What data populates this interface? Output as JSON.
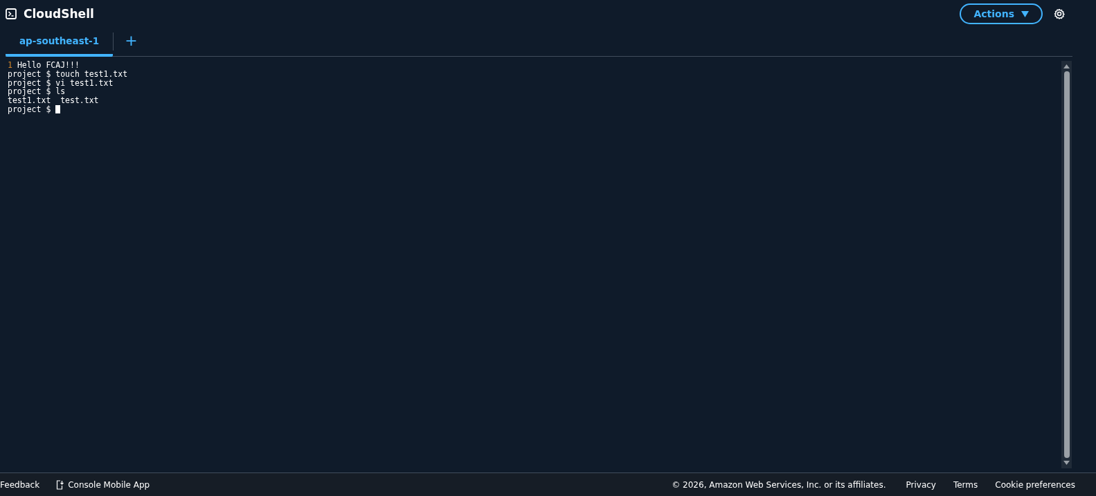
{
  "header": {
    "title": "CloudShell",
    "actions_button": "Actions"
  },
  "tabs": [
    {
      "label": "ap-southeast-1",
      "selected": true
    }
  ],
  "new_tab_button": "+",
  "terminal": {
    "lines": [
      {
        "kind": "numbered",
        "number": "1",
        "text": "Hello FCAJ!!!"
      },
      {
        "kind": "text",
        "text": "project $ touch test1.txt"
      },
      {
        "kind": "text",
        "text": "project $ vi test1.txt"
      },
      {
        "kind": "text",
        "text": "project $ ls"
      },
      {
        "kind": "text",
        "text": "test1.txt  test.txt"
      },
      {
        "kind": "prompt",
        "text": "project $ "
      }
    ]
  },
  "footer": {
    "left": [
      "Feedback",
      "Console Mobile App"
    ],
    "copyright": "© 2026, Amazon Web Services, Inc. or its affiliates.",
    "links": [
      "Privacy",
      "Terms",
      "Cookie preferences"
    ]
  }
}
